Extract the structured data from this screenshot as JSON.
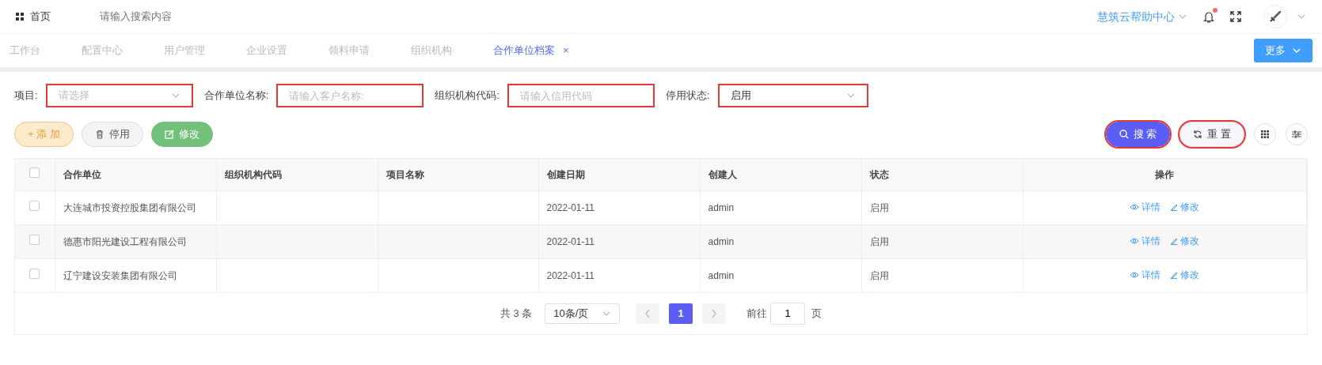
{
  "topbar": {
    "home": "首页",
    "search": {
      "placeholder": "请输入搜索内容"
    },
    "help": "慧筑云帮助中心",
    "notification_dot": true
  },
  "tabs": [
    {
      "label": "工作台",
      "selected": false
    },
    {
      "label": "配置中心",
      "selected": false
    },
    {
      "label": "用户管理",
      "selected": false
    },
    {
      "label": "企业设置",
      "selected": false
    },
    {
      "label": "领料申请",
      "selected": false
    },
    {
      "label": "组织机构",
      "selected": false
    },
    {
      "label": "合作单位档案",
      "selected": true,
      "close": "×"
    }
  ],
  "more_button": "更多",
  "filters": [
    {
      "kind": "select",
      "label": "项目:",
      "placeholder": "请选择",
      "highlighted": true
    },
    {
      "kind": "input",
      "label": "合作单位名称:",
      "placeholder": "请输入客户名称:",
      "highlighted": true
    },
    {
      "kind": "input",
      "label": "组织机构代码:",
      "placeholder": "请输入信用代码",
      "highlighted": true
    },
    {
      "kind": "select",
      "label": "停用状态:",
      "value": "启用",
      "highlighted": true
    }
  ],
  "actions": [
    {
      "kind": "add",
      "label": "+ 添 加"
    },
    {
      "kind": "disable",
      "label": "停用"
    },
    {
      "kind": "edit",
      "label": "修改"
    }
  ],
  "search_buttons": [
    {
      "kind": "search",
      "label": "搜 索",
      "highlighted": true
    },
    {
      "kind": "reset",
      "label": "重 置",
      "highlighted": true
    }
  ],
  "table": {
    "all_checked": false,
    "columns": [
      "合作单位",
      "组织机构代码",
      "项目名称",
      "创建日期",
      "创建人",
      "状态",
      "操作"
    ],
    "rows": [
      {
        "checked": false,
        "cells": [
          "大连城市投资控股集团有限公司",
          "",
          "",
          "2022-01-11",
          "admin",
          "启用"
        ],
        "links": [
          "详情",
          "修改"
        ]
      },
      {
        "checked": false,
        "cells": [
          "德惠市阳光建设工程有限公司",
          "",
          "",
          "2022-01-11",
          "admin",
          "启用"
        ],
        "links": [
          "详情",
          "修改"
        ]
      },
      {
        "checked": false,
        "cells": [
          "辽宁建设安装集团有限公司",
          "",
          "",
          "2022-01-11",
          "admin",
          "启用"
        ],
        "links": [
          "详情",
          "修改"
        ]
      }
    ]
  },
  "pagination": {
    "total": "共 3 条",
    "page_size": "10条/页",
    "pages": [
      {
        "label": "1",
        "selected": true
      }
    ],
    "goto_label": "前往",
    "goto_value": "1",
    "page_suffix": "页"
  }
}
